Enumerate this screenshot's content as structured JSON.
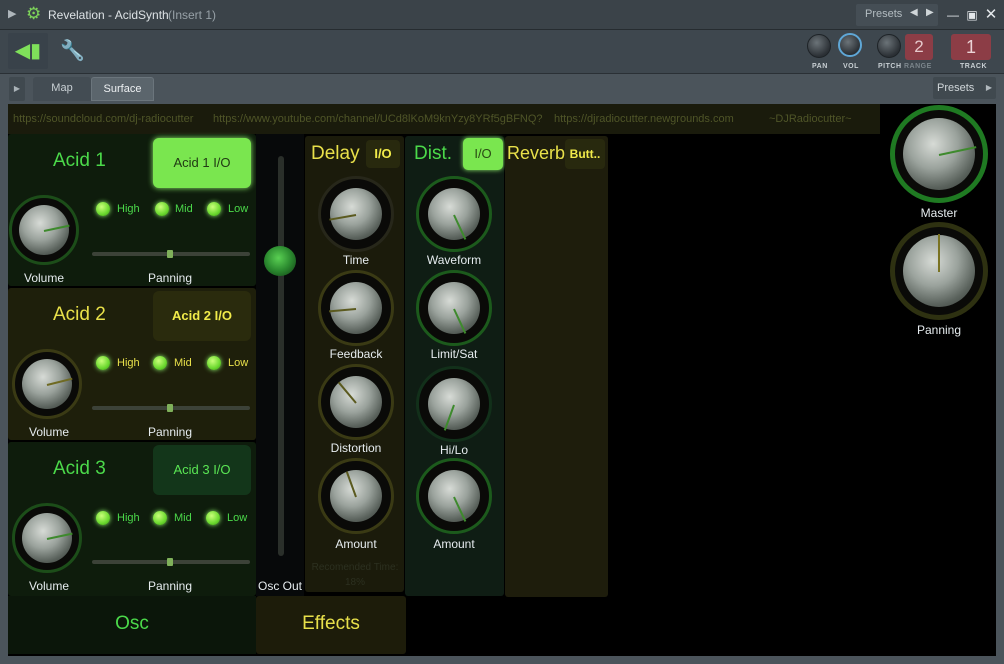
{
  "window": {
    "title": "Revelation - AcidSynth",
    "insert": "(Insert 1)",
    "presets_label": "Presets"
  },
  "toolbar": {
    "pan_label": "PAN",
    "vol_label": "VOL",
    "pitch_label": "PITCH",
    "range_label": "RANGE",
    "range_value": "2",
    "track_label": "TRACK",
    "track_value": "1"
  },
  "tabs": {
    "map": "Map",
    "surface": "Surface",
    "presets": "Presets"
  },
  "links": {
    "soundcloud": "https://soundcloud.com/dj-radiocutter",
    "youtube": "https://www.youtube.com/channel/UCd8lKoM9knYzy8YRf5gBFNQ?",
    "newgrounds": "https://djradiocutter.newgrounds.com",
    "signature": "~DJRadiocutter~"
  },
  "acids": [
    {
      "title": "Acid 1",
      "io": "Acid 1 I/O",
      "high": "High",
      "mid": "Mid",
      "low": "Low",
      "volume": "Volume",
      "panning": "Panning"
    },
    {
      "title": "Acid 2",
      "io": "Acid 2 I/O",
      "high": "High",
      "mid": "Mid",
      "low": "Low",
      "volume": "Volume",
      "panning": "Panning"
    },
    {
      "title": "Acid 3",
      "io": "Acid 3 I/O",
      "high": "High",
      "mid": "Mid",
      "low": "Low",
      "volume": "Volume",
      "panning": "Panning"
    }
  ],
  "osc_out": "Osc Out",
  "delay": {
    "title": "Delay",
    "io": "I/O",
    "knobs": [
      "Time",
      "Feedback",
      "Distortion",
      "Amount"
    ],
    "recommended": "Recomended Time:",
    "recommended_value": "18%"
  },
  "dist": {
    "title": "Dist.",
    "io": "I/O",
    "knobs": [
      "Waveform",
      "Limit/Sat",
      "Hi/Lo",
      "Amount"
    ]
  },
  "reverb": {
    "title": "Reverb",
    "button": "Butt.."
  },
  "master": {
    "master_label": "Master",
    "panning_label": "Panning"
  },
  "sections": {
    "osc": "Osc",
    "effects": "Effects"
  },
  "colors": {
    "green_accent": "#4bd94a",
    "yellow_accent": "#e8e04a",
    "io_on": "#7ae64f",
    "track_badge": "#8c3d46"
  }
}
